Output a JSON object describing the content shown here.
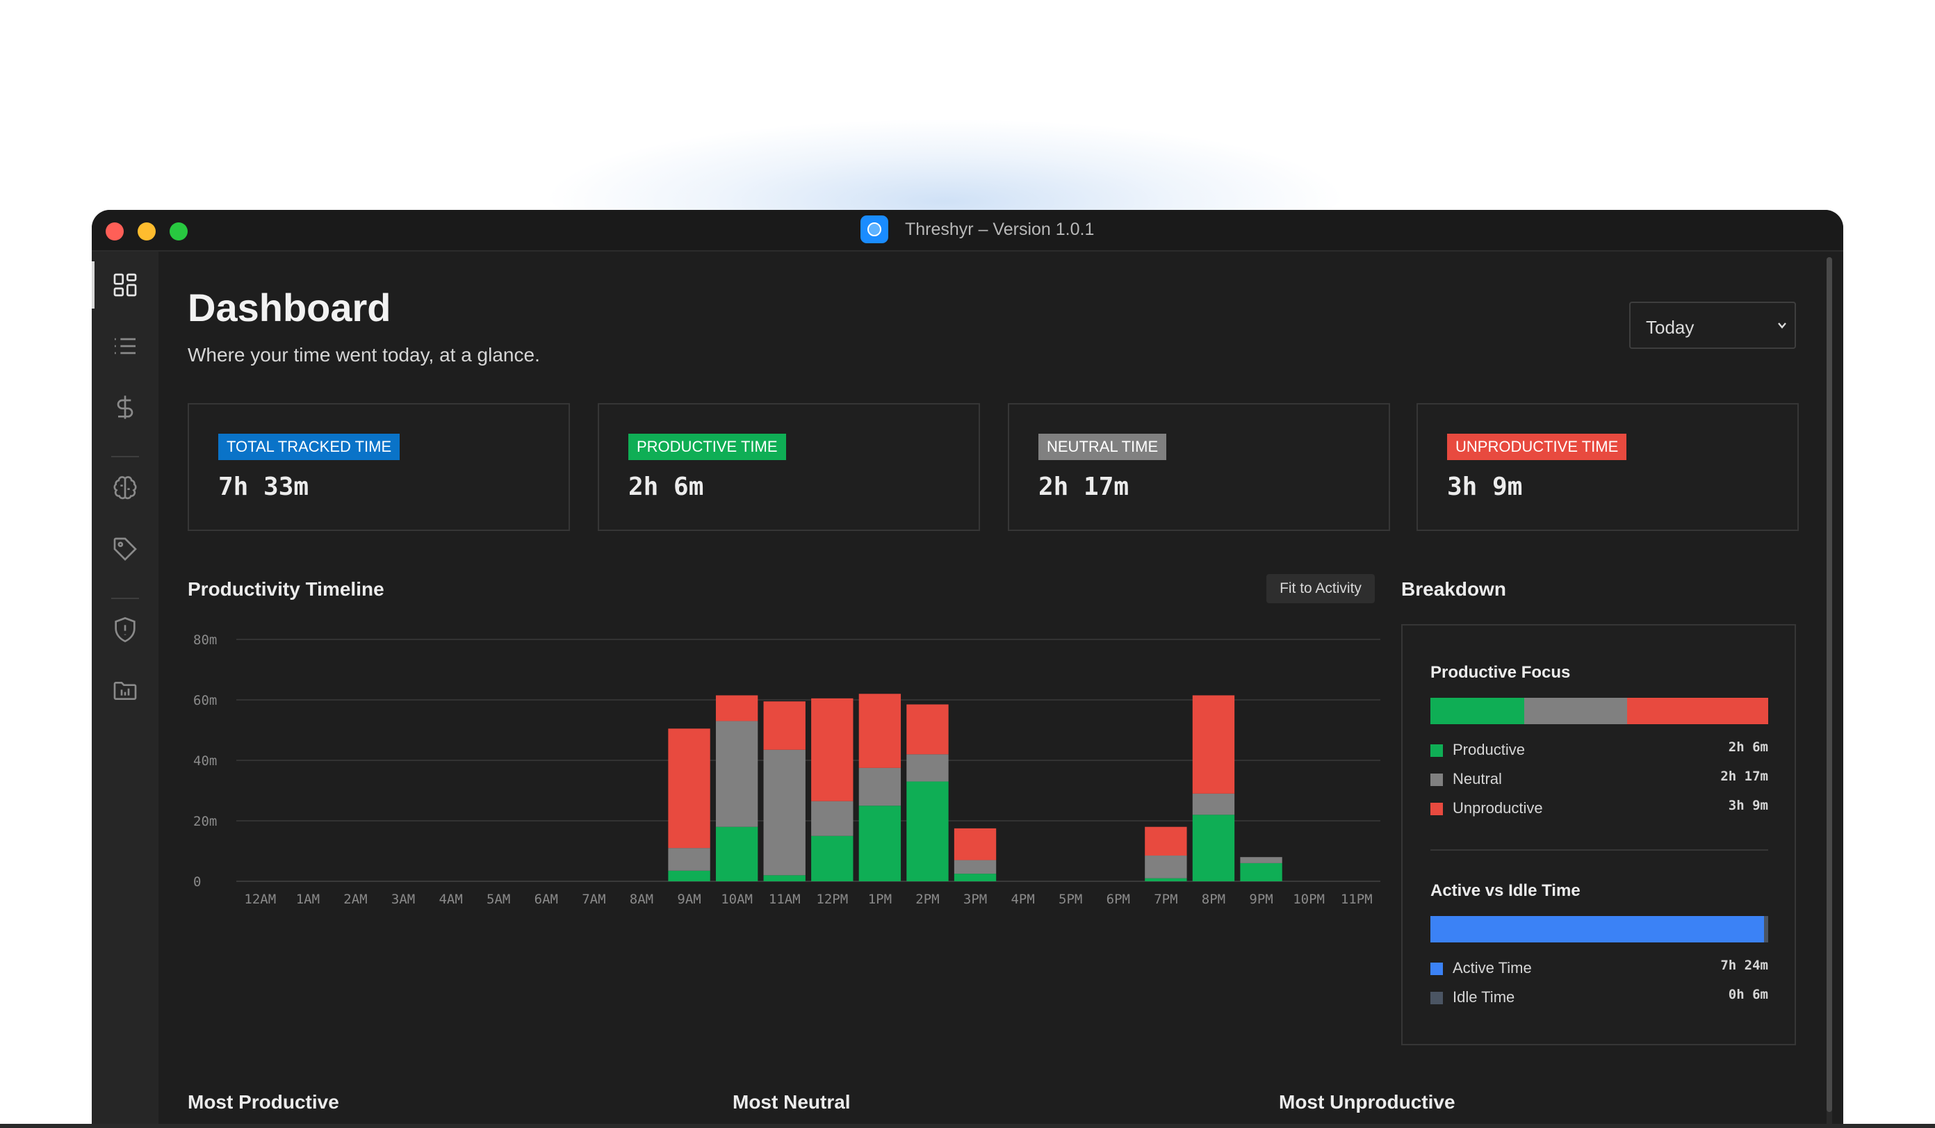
{
  "window": {
    "title": "Threshyr – Version 1.0.1"
  },
  "sidebar": {
    "items": [
      {
        "name": "dashboard",
        "icon": "dashboard-grid-icon",
        "active": true
      },
      {
        "name": "activity-list",
        "icon": "list-icon",
        "active": false
      },
      {
        "name": "billing",
        "icon": "dollar-icon",
        "active": false
      },
      {
        "name": "focus",
        "icon": "brain-icon",
        "active": false
      },
      {
        "name": "tags",
        "icon": "tag-icon",
        "active": false
      },
      {
        "name": "privacy",
        "icon": "shield-icon",
        "active": false
      },
      {
        "name": "projects",
        "icon": "folder-icon",
        "active": false
      }
    ]
  },
  "header": {
    "title": "Dashboard",
    "subtitle": "Where your time went today, at a glance.",
    "range_select": {
      "value": "Today"
    }
  },
  "stats": [
    {
      "label": "TOTAL TRACKED TIME",
      "value": "7h 33m",
      "color": "#0a73c8"
    },
    {
      "label": "PRODUCTIVE TIME",
      "value": "2h 6m",
      "color": "#0fae55"
    },
    {
      "label": "NEUTRAL TIME",
      "value": "2h 17m",
      "color": "#808080"
    },
    {
      "label": "UNPRODUCTIVE TIME",
      "value": "3h 9m",
      "color": "#e84a3f"
    }
  ],
  "timeline": {
    "title": "Productivity Timeline",
    "fit_button": "Fit to Activity"
  },
  "breakdown": {
    "title": "Breakdown",
    "focus": {
      "title": "Productive Focus",
      "items": [
        {
          "label": "Productive",
          "value": "2h 6m",
          "minutes": 126,
          "color": "#0fae55"
        },
        {
          "label": "Neutral",
          "value": "2h 17m",
          "minutes": 137,
          "color": "#808080"
        },
        {
          "label": "Unproductive",
          "value": "3h 9m",
          "minutes": 189,
          "color": "#e84a3f"
        }
      ]
    },
    "active_idle": {
      "title": "Active vs Idle Time",
      "items": [
        {
          "label": "Active Time",
          "value": "7h 24m",
          "minutes": 444,
          "color": "#3b82f6"
        },
        {
          "label": "Idle Time",
          "value": "0h 6m",
          "minutes": 6,
          "color": "#4b5563"
        }
      ]
    }
  },
  "bottom_sections": [
    "Most Productive",
    "Most Neutral",
    "Most Unproductive"
  ],
  "chart_data": {
    "type": "bar",
    "stacked": true,
    "categories": [
      "12AM",
      "1AM",
      "2AM",
      "3AM",
      "4AM",
      "5AM",
      "6AM",
      "7AM",
      "8AM",
      "9AM",
      "10AM",
      "11AM",
      "12PM",
      "1PM",
      "2PM",
      "3PM",
      "4PM",
      "5PM",
      "6PM",
      "7PM",
      "8PM",
      "9PM",
      "10PM",
      "11PM"
    ],
    "series": [
      {
        "name": "Productive",
        "color": "#0fae55",
        "values": [
          0,
          0,
          0,
          0,
          0,
          0,
          0,
          0,
          0,
          3.5,
          18,
          2,
          15,
          25,
          33,
          2.5,
          0,
          0,
          0,
          1,
          22,
          6,
          0,
          0
        ]
      },
      {
        "name": "Neutral",
        "color": "#808080",
        "values": [
          0,
          0,
          0,
          0,
          0,
          0,
          0,
          0,
          0,
          7.5,
          35,
          41.5,
          11.5,
          12.5,
          9,
          4.5,
          0,
          0,
          0,
          7.5,
          7,
          2,
          0,
          0
        ]
      },
      {
        "name": "Unproductive",
        "color": "#e84a3f",
        "values": [
          0,
          0,
          0,
          0,
          0,
          0,
          0,
          0,
          0,
          39.5,
          8.5,
          16,
          34,
          24.5,
          16.5,
          10.5,
          0,
          0,
          0,
          9.5,
          32.5,
          0,
          0,
          0
        ]
      }
    ],
    "y_ticks": [
      "0",
      "20m",
      "40m",
      "60m",
      "80m"
    ],
    "ylim": [
      0,
      80
    ],
    "grid": true
  }
}
